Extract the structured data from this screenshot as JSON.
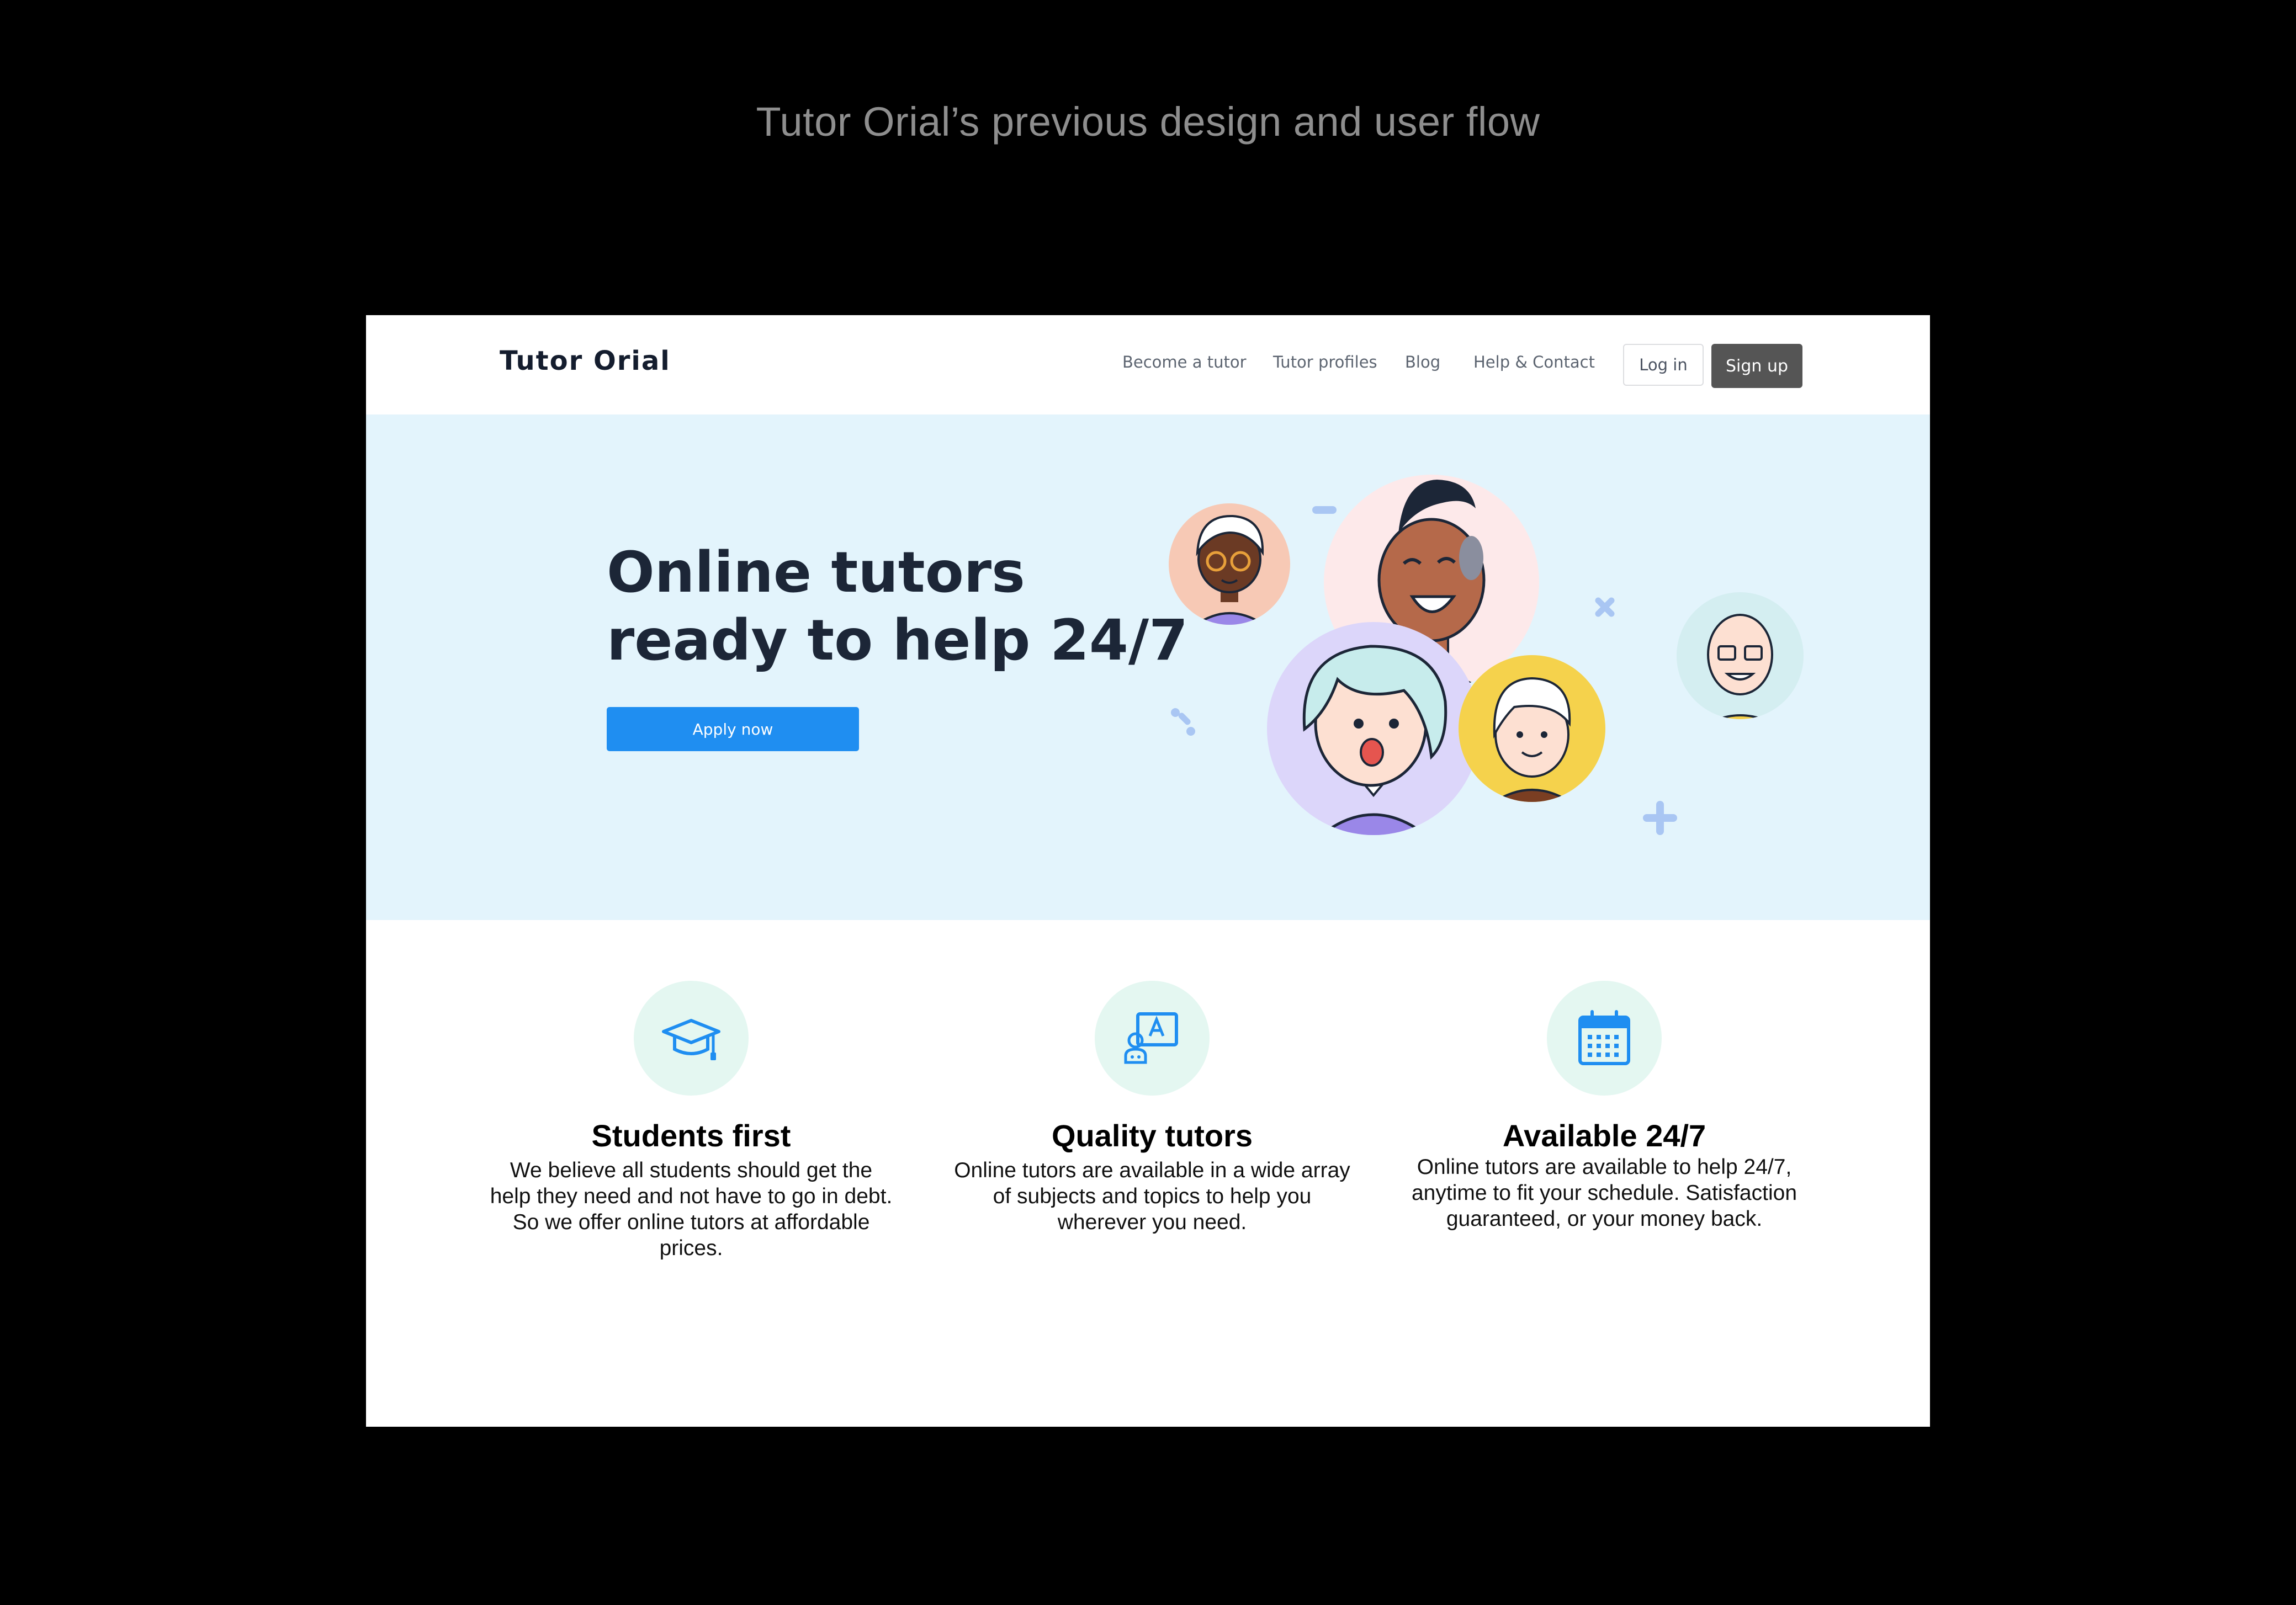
{
  "caption": "Tutor Orial’s previous design and user flow",
  "header": {
    "brand": "Tutor Orial",
    "nav": [
      {
        "label": "Become a tutor"
      },
      {
        "label": "Tutor profiles"
      },
      {
        "label": "Blog"
      },
      {
        "label": "Help & Contact"
      }
    ],
    "login_label": "Log in",
    "signup_label": "Sign up"
  },
  "hero": {
    "title_line1": "Online tutors",
    "title_line2": "ready to help 24/7",
    "cta_label": "Apply now"
  },
  "features": [
    {
      "icon": "graduation-cap-icon",
      "title": "Students first",
      "description": "We believe all students should get the help they need and not have to go in debt. So we offer online tutors at affordable prices."
    },
    {
      "icon": "tutor-board-icon",
      "title": "Quality tutors",
      "description": "Online tutors are available in a wide array of subjects and topics to help you wherever you need."
    },
    {
      "icon": "calendar-icon",
      "title": "Available 24/7",
      "description": "Online tutors are available to help 24/7, anytime to fit your schedule. Satisfaction guaranteed, or your money back."
    }
  ],
  "colors": {
    "hero_bg": "#e3f4fc",
    "cta": "#1f8ef1",
    "signup": "#555555",
    "feature_icon_bg": "#e4f7f1",
    "icon_blue": "#1f8ef1"
  }
}
